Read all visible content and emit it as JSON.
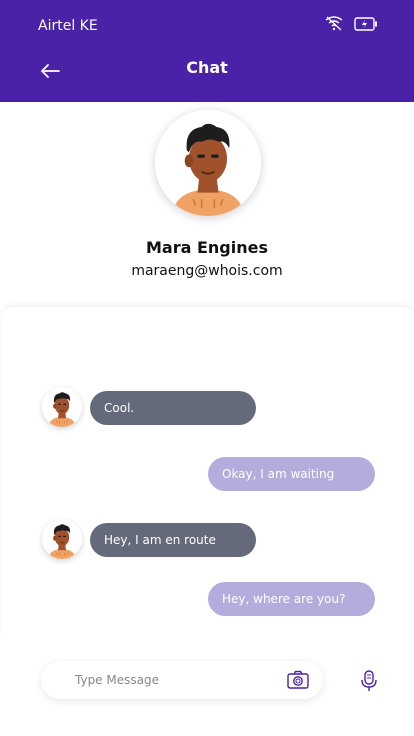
{
  "status_bar": {
    "carrier": "Airtel KE"
  },
  "header": {
    "title": "Chat"
  },
  "profile": {
    "name": "Mara Engines",
    "email": "maraeng@whois.com"
  },
  "messages": [
    {
      "direction": "in",
      "text": "Cool."
    },
    {
      "direction": "out",
      "text": "Okay, I am waiting"
    },
    {
      "direction": "in",
      "text": "Hey, I am en route"
    },
    {
      "direction": "out",
      "text": "Hey, where are you?"
    }
  ],
  "composer": {
    "placeholder": "Type Message"
  },
  "colors": {
    "header_bg": "#4a22a7",
    "incoming_bubble": "#656a7b",
    "outgoing_bubble": "#b3acdc"
  },
  "icons": [
    "wifi-icon",
    "battery-icon",
    "back-arrow-icon",
    "camera-icon",
    "microphone-icon"
  ]
}
